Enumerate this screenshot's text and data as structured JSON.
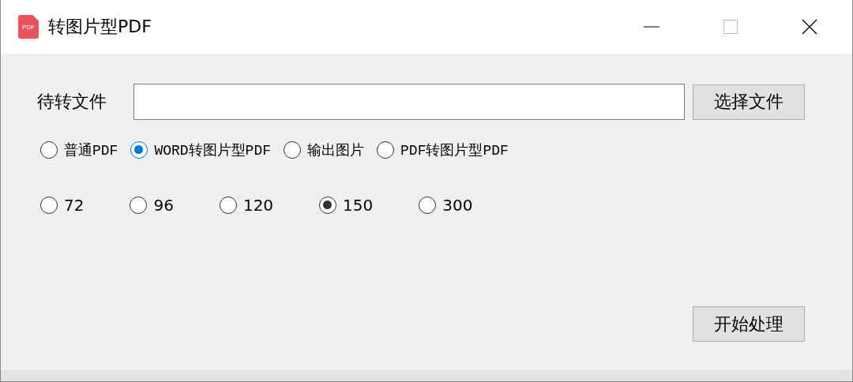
{
  "window": {
    "title": "转图片型PDF",
    "icon_text": "PDF"
  },
  "file_field": {
    "label": "待转文件"
  },
  "choose_button": "选择文件",
  "mode_options": {
    "items": [
      {
        "label": "普通PDF",
        "selected": false
      },
      {
        "label": "WORD转图片型PDF",
        "selected": true
      },
      {
        "label": "输出图片",
        "selected": false
      },
      {
        "label": "PDF转图片型PDF",
        "selected": false
      }
    ]
  },
  "dpi_options": {
    "items": [
      {
        "label": "72",
        "selected": false
      },
      {
        "label": "96",
        "selected": false
      },
      {
        "label": "120",
        "selected": false
      },
      {
        "label": "150",
        "selected": true
      },
      {
        "label": "300",
        "selected": false
      }
    ]
  },
  "start_button": "开始处理"
}
